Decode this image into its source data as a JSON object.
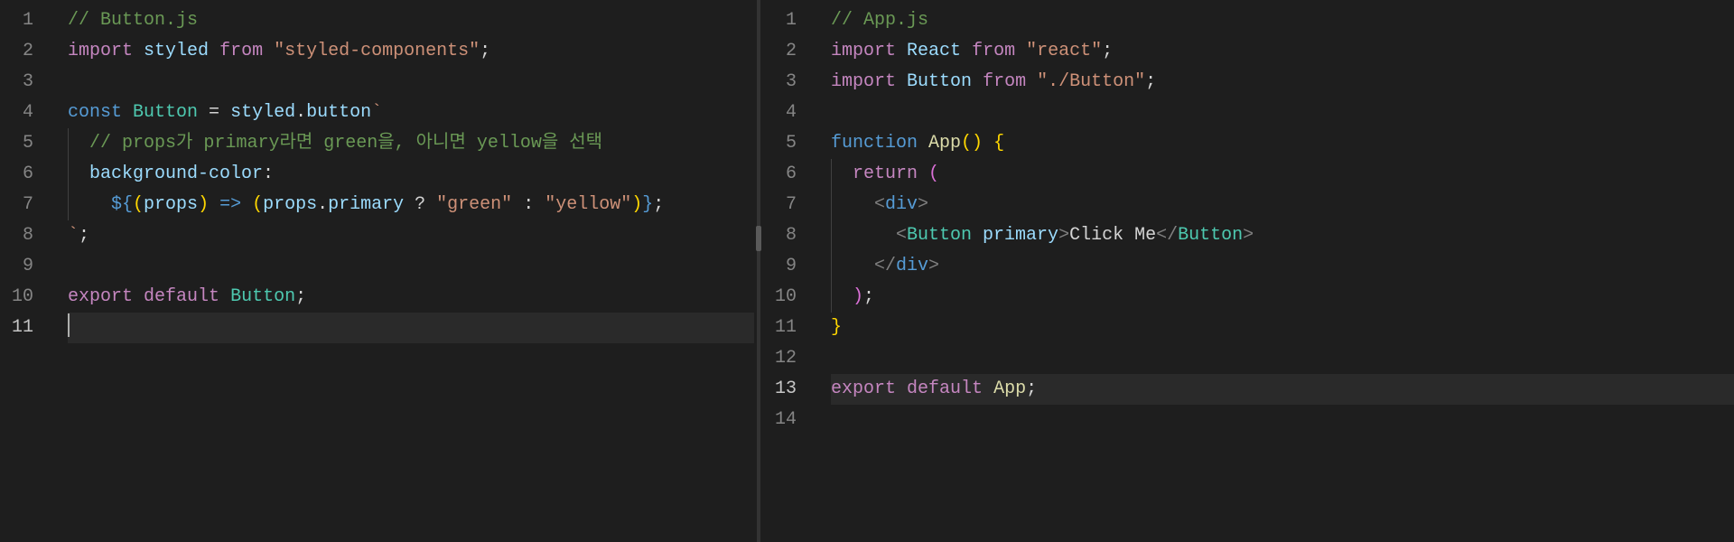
{
  "left": {
    "active_line": 11,
    "lines": [
      {
        "n": 1,
        "t": "comment",
        "text": "// Button.js"
      },
      {
        "n": 2,
        "t": "import_from",
        "kw": "import",
        "var": "styled",
        "kw2": "from",
        "str": "\"styled-components\"",
        "semi": ";"
      },
      {
        "n": 3,
        "t": "blank"
      },
      {
        "n": 4,
        "t": "const_styled",
        "kw": "const",
        "name": "Button",
        "eq": " = ",
        "obj": "styled",
        "dot": ".",
        "prop": "button",
        "tick": "`"
      },
      {
        "n": 5,
        "t": "comment_indent",
        "indent": "  ",
        "text": "// props가 primary라면 green을, 아니면 yellow을 선택"
      },
      {
        "n": 6,
        "t": "css_prop",
        "indent": "  ",
        "prop": "background-color",
        "colon": ":"
      },
      {
        "n": 7,
        "t": "interp",
        "indent": "    ",
        "d1": "${",
        "p1": "(",
        "arg": "props",
        "p2": ")",
        "arrow": " => ",
        "p3": "(",
        "obj": "props",
        "dot": ".",
        "prop": "primary",
        "tern": " ? ",
        "s1": "\"green\"",
        "col": " : ",
        "s2": "\"yellow\"",
        "p4": ")",
        "d2": "}",
        "semi": ";"
      },
      {
        "n": 8,
        "t": "tick_end",
        "tick": "`",
        "semi": ";"
      },
      {
        "n": 9,
        "t": "blank"
      },
      {
        "n": 10,
        "t": "export",
        "kw1": "export",
        "kw2": "default",
        "name": "Button",
        "semi": ";"
      },
      {
        "n": 11,
        "t": "cursor"
      }
    ]
  },
  "right": {
    "active_line": 13,
    "lines": [
      {
        "n": 1,
        "t": "comment",
        "text": "// App.js"
      },
      {
        "n": 2,
        "t": "import_from",
        "kw": "import",
        "var": "React",
        "kw2": "from",
        "str": "\"react\"",
        "semi": ";"
      },
      {
        "n": 3,
        "t": "import_from",
        "kw": "import",
        "var": "Button",
        "kw2": "from",
        "str": "\"./Button\"",
        "semi": ";"
      },
      {
        "n": 4,
        "t": "blank"
      },
      {
        "n": 5,
        "t": "func_decl",
        "kw": "function",
        "name": "App",
        "paren": "()",
        "brace": " {"
      },
      {
        "n": 6,
        "t": "return",
        "indent": "  ",
        "kw": "return",
        "paren": " ("
      },
      {
        "n": 7,
        "t": "jsx_open",
        "indent": "    ",
        "lt": "<",
        "tag": "div",
        "gt": ">"
      },
      {
        "n": 8,
        "t": "jsx_button",
        "indent": "      ",
        "lt": "<",
        "tag": "Button",
        "attr": " primary",
        "gt": ">",
        "text": "Click Me",
        "lt2": "</",
        "tag2": "Button",
        "gt2": ">"
      },
      {
        "n": 9,
        "t": "jsx_close",
        "indent": "    ",
        "lt": "</",
        "tag": "div",
        "gt": ">"
      },
      {
        "n": 10,
        "t": "close_paren",
        "indent": "  ",
        "paren": ")",
        "semi": ";"
      },
      {
        "n": 11,
        "t": "close_brace",
        "brace": "}"
      },
      {
        "n": 12,
        "t": "blank"
      },
      {
        "n": 13,
        "t": "export",
        "kw1": "export",
        "kw2": "default",
        "name": "App",
        "semi": ";"
      },
      {
        "n": 14,
        "t": "blank"
      }
    ]
  }
}
